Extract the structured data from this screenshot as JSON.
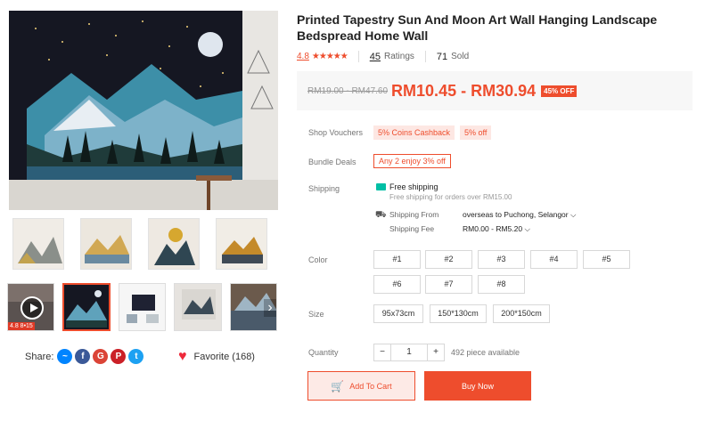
{
  "product": {
    "title": "Printed Tapestry Sun And Moon Art Wall Hanging Landscape Bedspread Home Wall",
    "rating": "4.8",
    "stars": "★★★★★",
    "ratings_count": "45",
    "ratings_label": "Ratings",
    "sold_count": "71",
    "sold_label": "Sold"
  },
  "price": {
    "original": "RM19.00 - RM47.60",
    "current": "RM10.45 - RM30.94",
    "discount": "45% OFF"
  },
  "vouchers": {
    "label": "Shop Vouchers",
    "items": [
      "5% Coins Cashback",
      "5% off"
    ]
  },
  "bundle": {
    "label": "Bundle Deals",
    "value": "Any 2 enjoy 3% off"
  },
  "shipping": {
    "label": "Shipping",
    "free_title": "Free shipping",
    "free_sub": "Free shipping for orders over RM15.00",
    "from_label": "Shipping From",
    "from_value": "overseas to Puchong, Selangor ⌵",
    "fee_label": "Shipping Fee",
    "fee_value": "RM0.00 - RM5.20 ⌵"
  },
  "color": {
    "label": "Color",
    "options": [
      "#1",
      "#2",
      "#3",
      "#4",
      "#5",
      "#6",
      "#7",
      "#8"
    ]
  },
  "size": {
    "label": "Size",
    "options": [
      "95x73cm",
      "150*130cm",
      "200*150cm"
    ]
  },
  "quantity": {
    "label": "Quantity",
    "minus": "−",
    "value": "1",
    "plus": "+",
    "available": "492 piece available"
  },
  "actions": {
    "add_to_cart": "Add To Cart",
    "buy_now": "Buy Now"
  },
  "share": {
    "label": "Share:",
    "icons": [
      "messenger-icon",
      "facebook-icon",
      "google-plus-icon",
      "pinterest-icon",
      "twitter-icon"
    ]
  },
  "favorite": {
    "label": "Favorite (168)"
  },
  "gallery": {
    "badge": "4.8  8•15"
  },
  "colors": {
    "accent": "#ee4d2d",
    "price_bg": "#f7f7f7"
  }
}
